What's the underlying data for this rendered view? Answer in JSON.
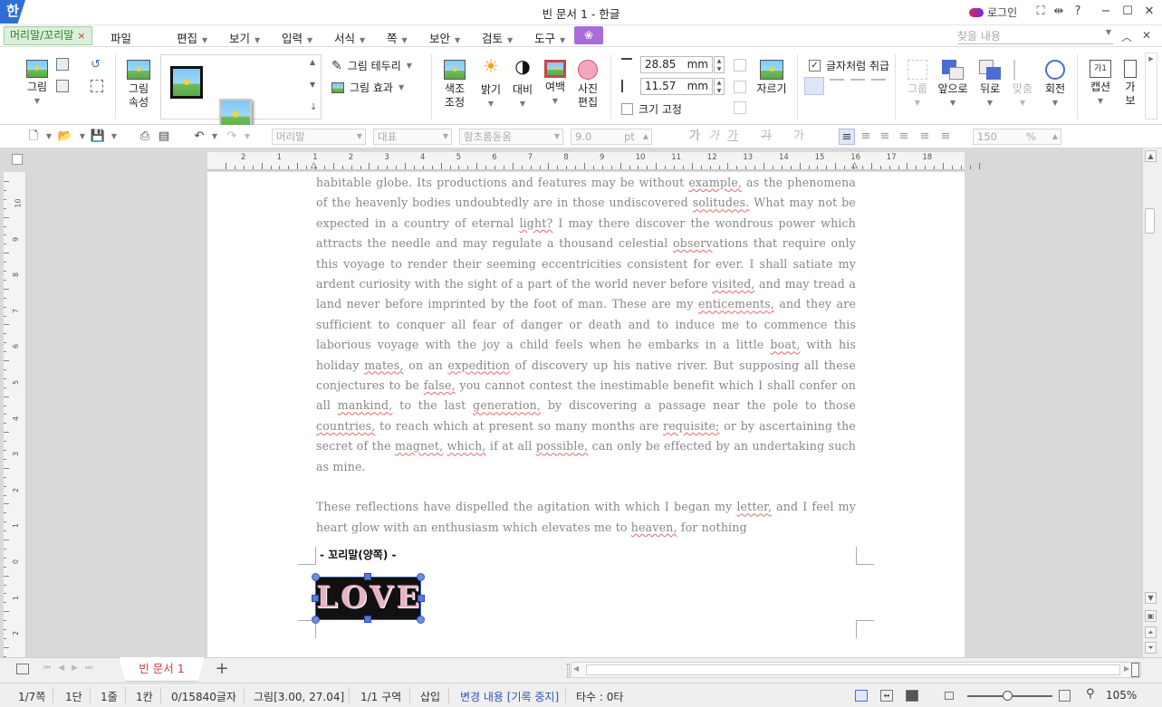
{
  "titlebar": {
    "app_logo": "한",
    "title": "빈 문서 1 - 한글",
    "login": "로그인",
    "icons": [
      "fullscreen-icon",
      "split-icon",
      "help-icon",
      "minimize-icon",
      "maximize-icon",
      "close-icon"
    ]
  },
  "menubar": {
    "context_tab": "머리말/꼬리말",
    "context_close": "×",
    "file": "파일",
    "items": [
      "편집",
      "보기",
      "입력",
      "서식",
      "쪽",
      "보안",
      "검토",
      "도구"
    ],
    "search_placeholder": "찾을 내용"
  },
  "ribbon": {
    "picture": "그림",
    "picture_props_1": "그림",
    "picture_props_2": "속성",
    "border": "그림 테두리",
    "effect": "그림 효과",
    "color_adjust_1": "색조",
    "color_adjust_2": "조정",
    "brightness": "밝기",
    "contrast": "대비",
    "margin": "여백",
    "photo_edit_1": "사진",
    "photo_edit_2": "편집",
    "width_value": "28.85",
    "height_value": "11.57",
    "unit": "mm",
    "fix_size": "크기 고정",
    "crop": "자르기",
    "treat_as_char": "글자처럼 취급",
    "group": "그룹",
    "bring_forward": "앞으로",
    "send_backward": "뒤로",
    "align": "맞춤",
    "rotate": "회전",
    "caption": "캡션",
    "caption_glyph": "가1",
    "more_1": "가",
    "more_2": "보"
  },
  "toolbar2": {
    "style": "머리말",
    "font_category": "대표",
    "font": "함초롬돋움",
    "font_size": "9.0",
    "size_unit": "pt",
    "zoom": "150",
    "zoom_unit": "%"
  },
  "document": {
    "paragraphs": [
      [
        {
          "t": "habitable globe. Its productions and features may be without "
        },
        {
          "t": "example,",
          "w": true
        },
        {
          "t": " as the phenomena of the heavenly bodies undoubtedly are in those undiscovered "
        },
        {
          "t": "solitudes.",
          "w": true
        },
        {
          "t": " What may not be expected in a country of eternal "
        },
        {
          "t": "light?",
          "w": true
        },
        {
          "t": " I may there discover the wondrous power which attracts the needle and may regulate a thousand celestial "
        },
        {
          "t": "observ",
          "w": true
        },
        {
          "t": "ations that require only this voyage to render their seeming eccentricities consistent for ever. I shall satiate my ardent curiosity with the sight of a part of the world never before "
        },
        {
          "t": "visited,",
          "w": true
        },
        {
          "t": " and may tread a land never before imprinted by the foot of man. These are my "
        },
        {
          "t": "enticements,",
          "w": true
        },
        {
          "t": " and they are sufficient to conquer all fear of danger or death and to induce me to commence this laborious voyage with the joy a child feels when he embarks in a little "
        },
        {
          "t": "boat,",
          "w": true
        },
        {
          "t": " with his holiday "
        },
        {
          "t": "mates,",
          "w": true
        },
        {
          "t": " on an "
        },
        {
          "t": "expedition",
          "w": true
        },
        {
          "t": " of discovery up his native river. But supposing all these conjectures to be "
        },
        {
          "t": "false,",
          "w": true
        },
        {
          "t": " you cannot contest the inestimable benefit which I shall confer on all "
        },
        {
          "t": "mankind,",
          "w": true
        },
        {
          "t": " to the last "
        },
        {
          "t": "generation,",
          "w": true
        },
        {
          "t": " by discovering a passage near the pole to those "
        },
        {
          "t": "countries,",
          "w": true
        },
        {
          "t": " to reach which at present so many months are "
        },
        {
          "t": "requisite;",
          "w": true
        },
        {
          "t": " or by ascertaining the secret of the "
        },
        {
          "t": "magnet,",
          "w": true
        },
        {
          "t": " "
        },
        {
          "t": "which,",
          "w": true
        },
        {
          "t": " if at all "
        },
        {
          "t": "possible,",
          "w": true
        },
        {
          "t": " can only be effected by an undertaking such as mine."
        }
      ],
      [
        {
          "t": "These reflections have dispelled the agitation with which I began my "
        },
        {
          "t": "letter,",
          "w": true
        },
        {
          "t": " and I feel my heart glow with an enthusiasm which elevates me to "
        },
        {
          "t": "heaven,",
          "w": true
        },
        {
          "t": " for nothing"
        }
      ]
    ],
    "footer_label": "- 꼬리말(양쪽) -",
    "image_text": "LOVE"
  },
  "tabs": {
    "doc_tab": "빈 문서 1",
    "add": "+"
  },
  "ruler_h": [
    "2",
    "1",
    "1",
    "2",
    "3",
    "4",
    "5",
    "6",
    "7",
    "8",
    "9",
    "10",
    "11",
    "12",
    "13",
    "14",
    "15",
    "16",
    "17",
    "18"
  ],
  "ruler_v": [
    "10",
    "9",
    "8",
    "7",
    "6",
    "5",
    "4",
    "3",
    "2",
    "1",
    "0",
    "1",
    "2"
  ],
  "statusbar": {
    "page": "1/7쪽",
    "column": "1단",
    "line": "1줄",
    "cell": "1칸",
    "chars": "0/15840글자",
    "object": "그림[3.00, 27.04]",
    "section": "1/1 구역",
    "insert": "삽입",
    "track": "변경 내용 [기록 중지]",
    "keystrokes": "타수 : 0타",
    "zoom": "105%"
  },
  "colors": {
    "accent_blue": "#2d6fd6",
    "context_tab_green": "#dbf0da",
    "menu_purple": "#a86cd9",
    "doc_tab_red": "#d04040",
    "spell_underline": "#e06a6a"
  }
}
